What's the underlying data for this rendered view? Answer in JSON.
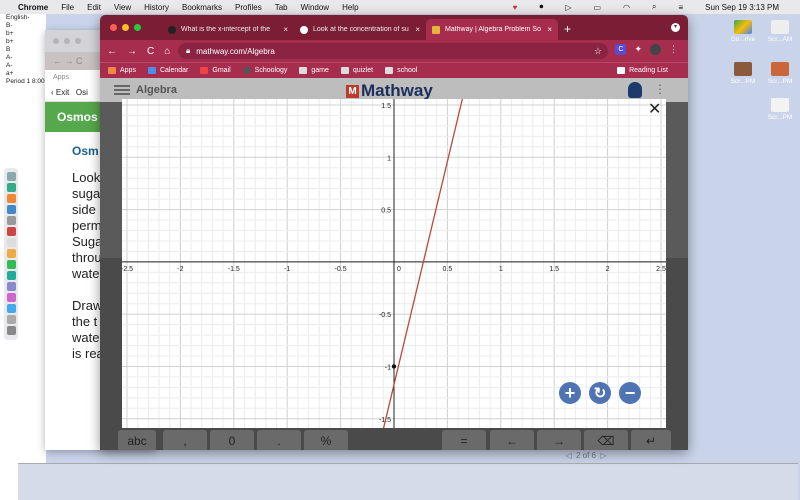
{
  "menubar": {
    "app": "Chrome",
    "items": [
      "File",
      "Edit",
      "View",
      "History",
      "Bookmarks",
      "Profiles",
      "Tab",
      "Window",
      "Help"
    ],
    "datetime": "Sun Sep 19  3:13 PM"
  },
  "desktop_left": [
    "English-",
    "",
    "B-",
    "b+",
    "b+",
    "B",
    "A-",
    "A-",
    "a+",
    "",
    "",
    "Period 1 8:00"
  ],
  "desktop_icons": [
    "Go...rive",
    "Scr...AM",
    "Scr...PM",
    "Scr...PM",
    "Scr...PM",
    "Scr...PM"
  ],
  "bg_window": {
    "exit": "Exit",
    "nav_partial": "Osi",
    "banner": "Osmos",
    "heading": "Osm",
    "body_lines": [
      "Look",
      "suga",
      "side",
      "perm",
      "Suga",
      "throu",
      "wate",
      "",
      "Draw",
      "the t",
      "wate",
      "is rea"
    ],
    "pager": "2 of 6"
  },
  "tabs": [
    {
      "title": "What is the x-intercept of the"
    },
    {
      "title": "Look at the concentration of su"
    },
    {
      "title": "Mathway | Algebra Problem So"
    }
  ],
  "url": "mathway.com/Algebra",
  "bookmarks": [
    "Apps",
    "Calendar",
    "Gmail",
    "Schoology",
    "game",
    "quizlet",
    "school"
  ],
  "reading_list": "Reading List",
  "mathway": {
    "section": "Algebra",
    "logo": "Mathway"
  },
  "keys": [
    "abc",
    ",",
    "0",
    ".",
    "%",
    "=",
    "←",
    "→"
  ],
  "chart_data": {
    "type": "line",
    "x_ticks": [
      "-2.5",
      "-2",
      "-1.5",
      "-1",
      "-0.5",
      "0",
      "0.5",
      "1",
      "1.5",
      "2",
      "2.5"
    ],
    "y_ticks": [
      "-1.5",
      "-1",
      "-0.5",
      "0.5",
      "1",
      "1.5"
    ],
    "xlim": [
      -2.5,
      2.5
    ],
    "ylim": [
      -1.55,
      1.5
    ],
    "series": [
      {
        "x": [
          -0.1,
          0.65
        ],
        "y": [
          -1.6,
          1.6
        ],
        "color": "#b94a3a"
      }
    ],
    "points": [
      {
        "x": 0,
        "y": -1
      }
    ],
    "grid": true
  }
}
